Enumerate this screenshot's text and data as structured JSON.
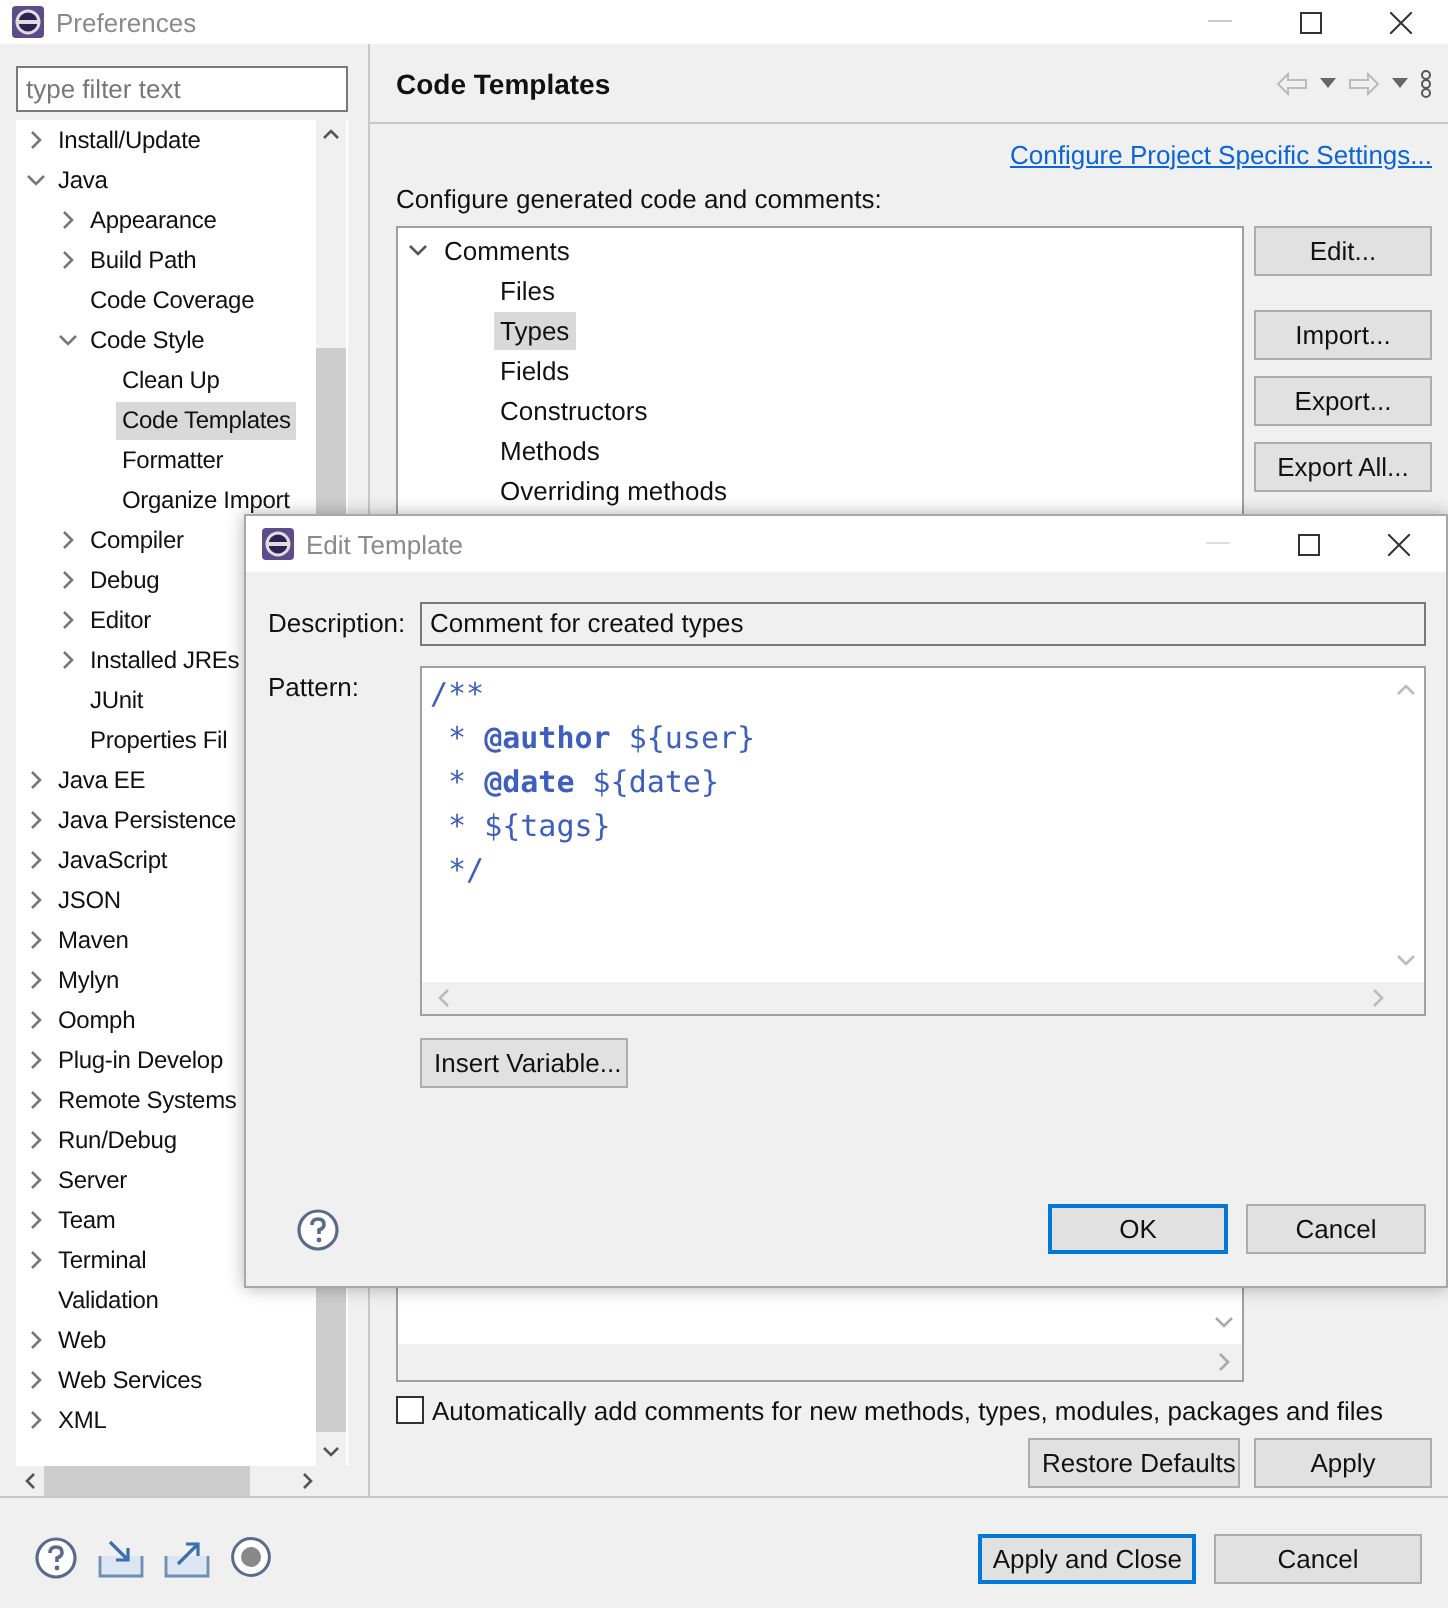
{
  "window": {
    "title": "Preferences"
  },
  "filter": {
    "placeholder": "type filter text"
  },
  "sidebar": {
    "items": [
      {
        "label": "Install/Update",
        "kind": "folder",
        "expanded": false,
        "selected": false
      },
      {
        "label": "Java",
        "kind": "folder",
        "expanded": true,
        "selected": false,
        "children": [
          {
            "label": "Appearance",
            "kind": "folder",
            "expanded": false,
            "selected": false
          },
          {
            "label": "Build Path",
            "kind": "folder",
            "expanded": false,
            "selected": false
          },
          {
            "label": "Code Coverage",
            "kind": "leaf",
            "selected": false
          },
          {
            "label": "Code Style",
            "kind": "folder",
            "expanded": true,
            "selected": false,
            "children": [
              {
                "label": "Clean Up",
                "selected": false
              },
              {
                "label": "Code Templates",
                "selected": true
              },
              {
                "label": "Formatter",
                "selected": false
              },
              {
                "label": "Organize Import",
                "selected": false
              }
            ]
          },
          {
            "label": "Compiler",
            "kind": "folder",
            "expanded": false,
            "selected": false
          },
          {
            "label": "Debug",
            "kind": "folder",
            "expanded": false,
            "selected": false
          },
          {
            "label": "Editor",
            "kind": "folder",
            "expanded": false,
            "selected": false
          },
          {
            "label": "Installed JREs",
            "kind": "folder",
            "expanded": false,
            "selected": false
          },
          {
            "label": "JUnit",
            "kind": "leaf",
            "selected": false
          },
          {
            "label": "Properties Fil",
            "kind": "leaf",
            "selected": false
          }
        ]
      },
      {
        "label": "Java EE",
        "kind": "folder",
        "expanded": false,
        "selected": false
      },
      {
        "label": "Java Persistence",
        "kind": "folder",
        "expanded": false,
        "selected": false
      },
      {
        "label": "JavaScript",
        "kind": "folder",
        "expanded": false,
        "selected": false
      },
      {
        "label": "JSON",
        "kind": "folder",
        "expanded": false,
        "selected": false
      },
      {
        "label": "Maven",
        "kind": "folder",
        "expanded": false,
        "selected": false
      },
      {
        "label": "Mylyn",
        "kind": "folder",
        "expanded": false,
        "selected": false
      },
      {
        "label": "Oomph",
        "kind": "folder",
        "expanded": false,
        "selected": false
      },
      {
        "label": "Plug-in Develop",
        "kind": "folder",
        "expanded": false,
        "selected": false
      },
      {
        "label": "Remote Systems",
        "kind": "folder",
        "expanded": false,
        "selected": false
      },
      {
        "label": "Run/Debug",
        "kind": "folder",
        "expanded": false,
        "selected": false
      },
      {
        "label": "Server",
        "kind": "folder",
        "expanded": false,
        "selected": false
      },
      {
        "label": "Team",
        "kind": "folder",
        "expanded": false,
        "selected": false
      },
      {
        "label": "Terminal",
        "kind": "folder",
        "expanded": false,
        "selected": false
      },
      {
        "label": "Validation",
        "kind": "leaf",
        "selected": false
      },
      {
        "label": "Web",
        "kind": "folder",
        "expanded": false,
        "selected": false
      },
      {
        "label": "Web Services",
        "kind": "folder",
        "expanded": false,
        "selected": false
      },
      {
        "label": "XML",
        "kind": "folder",
        "expanded": false,
        "selected": false
      }
    ]
  },
  "page": {
    "title": "Code Templates",
    "link": "Configure Project Specific Settings...",
    "intro": "Configure generated code and comments:",
    "templates": [
      {
        "label": "Comments",
        "kind": "folder",
        "expanded": true,
        "selected": false,
        "children": [
          {
            "label": "Files",
            "selected": false
          },
          {
            "label": "Types",
            "selected": true
          },
          {
            "label": "Fields",
            "selected": false
          },
          {
            "label": "Constructors",
            "selected": false
          },
          {
            "label": "Methods",
            "selected": false
          },
          {
            "label": "Overriding methods",
            "selected": false
          }
        ]
      }
    ],
    "side_buttons": [
      "Edit...",
      "Import...",
      "Export...",
      "Export All..."
    ],
    "auto_comments": {
      "label": "Automatically add comments for new methods, types, modules, packages and files",
      "checked": false
    },
    "buttons": [
      "Restore Defaults",
      "Apply"
    ]
  },
  "footer_buttons": [
    {
      "label": "Apply and Close",
      "default": true
    },
    {
      "label": "Cancel",
      "default": false
    }
  ],
  "dialog": {
    "title": "Edit Template",
    "description_label": "Description:",
    "description": "Comment for created types",
    "pattern_label": "Pattern:",
    "pattern": [
      "/**",
      " * **@author** ${user}",
      " * **@date** ${date}",
      " * ${tags}",
      " */"
    ],
    "insert_button": "Insert Variable...",
    "buttons": [
      {
        "label": "OK",
        "default": true
      },
      {
        "label": "Cancel",
        "default": false
      }
    ]
  }
}
